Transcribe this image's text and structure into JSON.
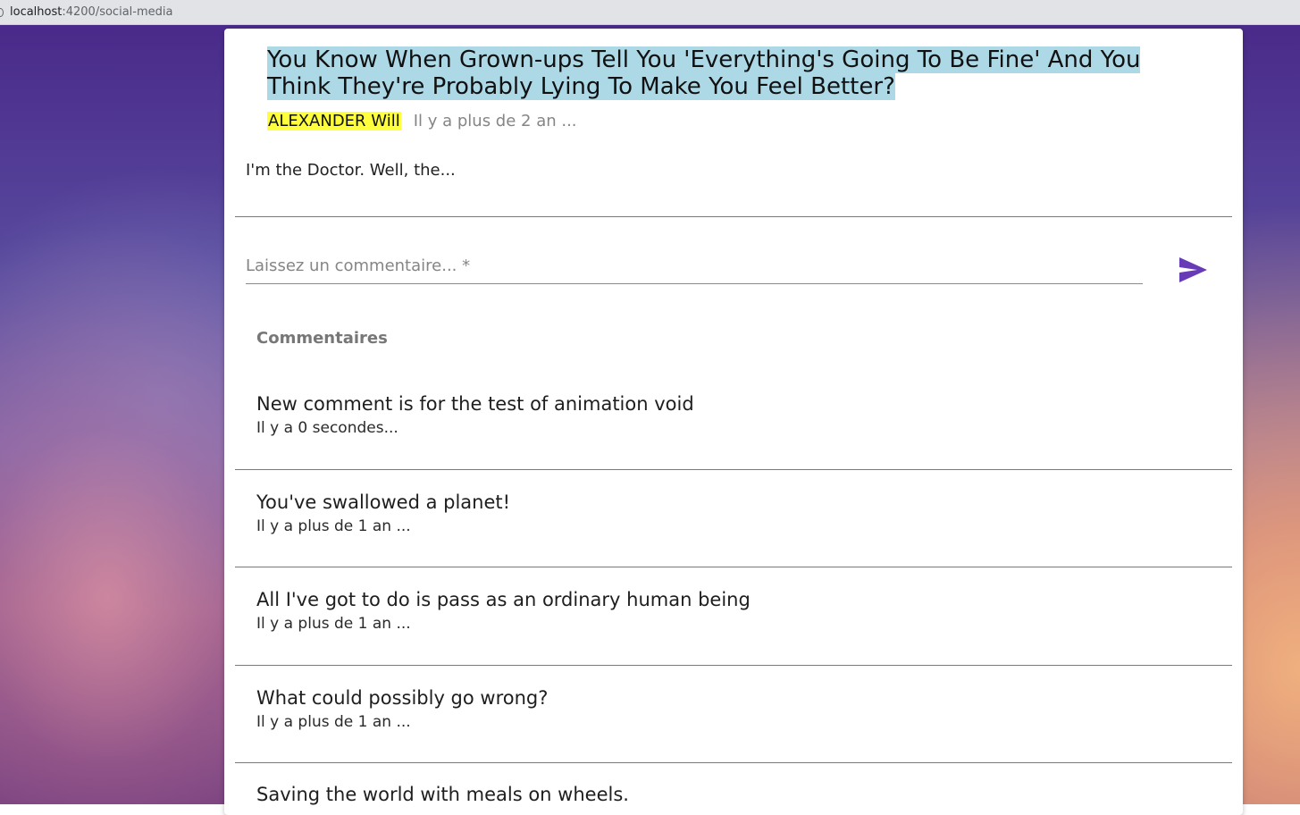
{
  "browser": {
    "url_host": "localhost",
    "url_path": ":4200/social-media"
  },
  "post": {
    "title": "You Know When Grown-ups Tell You 'Everything's Going To Be Fine' And You Think They're Probably Lying To Make You Feel Better?",
    "author": "ALEXANDER Will",
    "date": "Il y a plus de 2 an ...",
    "excerpt": "I'm the Doctor. Well, the..."
  },
  "comment_form": {
    "placeholder": "Laissez un commentaire... *",
    "value": "",
    "send_icon": "send-icon"
  },
  "comments": {
    "heading": "Commentaires",
    "items": [
      {
        "text": "New comment is for the test of animation void",
        "date": "Il y a 0 secondes..."
      },
      {
        "text": "You've swallowed a planet!",
        "date": "Il y a plus de 1 an ..."
      },
      {
        "text": "All I've got to do is pass as an ordinary human being",
        "date": "Il y a plus de 1 an ..."
      },
      {
        "text": "What could possibly go wrong?",
        "date": "Il y a plus de 1 an ..."
      },
      {
        "text": "Saving the world with meals on wheels.",
        "date": ""
      }
    ]
  },
  "colors": {
    "title_highlight": "#add8e6",
    "author_highlight": "#ffff3c",
    "accent": "#673ab7"
  }
}
